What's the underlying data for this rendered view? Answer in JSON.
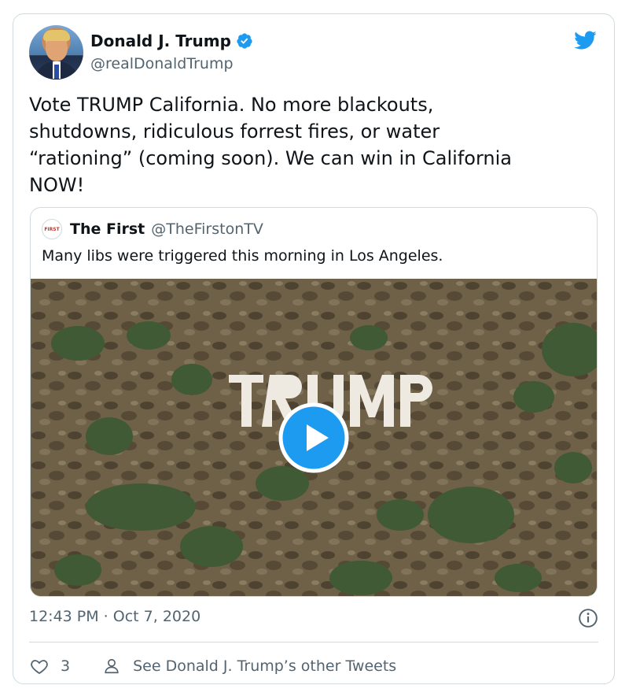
{
  "author": {
    "name": "Donald J. Trump",
    "handle": "@realDonaldTrump"
  },
  "tweet": {
    "text": "Vote TRUMP California. No more blackouts,\nshutdowns, ridiculous forrest fires, or water\n“rationing” (coming soon). We can win in California\nNOW!",
    "timestamp": "12:43 PM · Oct 7, 2020",
    "like_count": "3",
    "see_more_label": "See Donald J. Trump’s other Tweets"
  },
  "quoted": {
    "logo_text": "FIRST",
    "name": "The First",
    "handle": "@TheFirstonTV",
    "text": "Many libs were triggered this morning in Los Angeles.",
    "video_sign_text": "TRUMP"
  },
  "colors": {
    "accent": "#1d9bf0",
    "text": "#0f1419",
    "secondary": "#536471",
    "border": "#cfd9de"
  },
  "icons": [
    "verified-badge-icon",
    "twitter-bird-icon",
    "play-icon",
    "info-icon",
    "heart-icon",
    "person-icon"
  ]
}
